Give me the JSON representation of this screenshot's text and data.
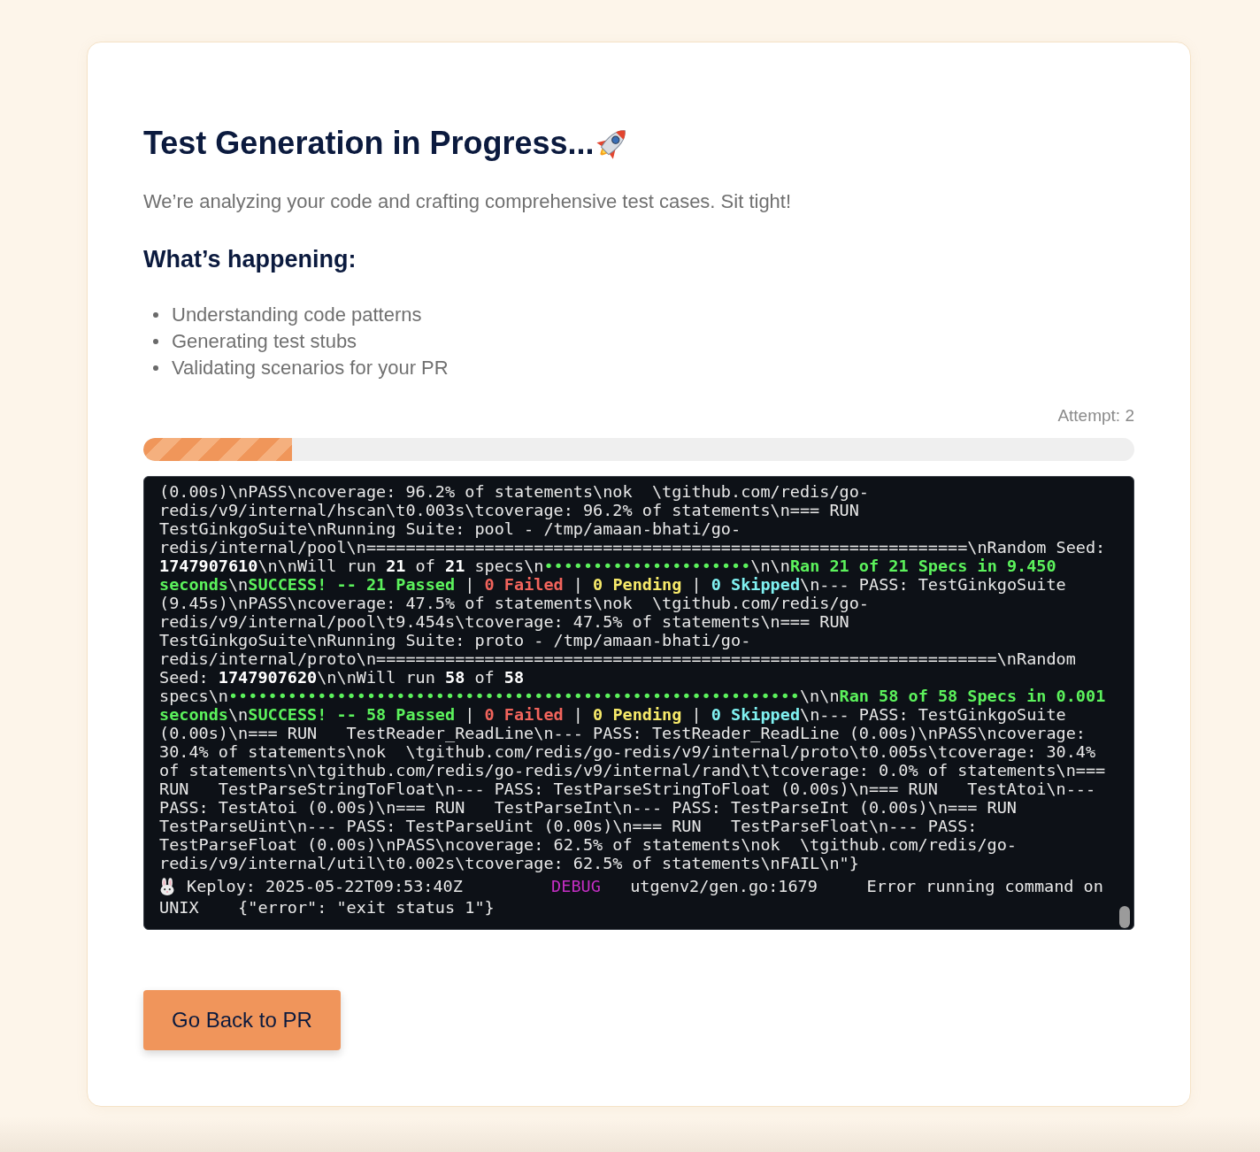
{
  "title": "Test Generation in Progress...",
  "subtitle": "We’re analyzing your code and crafting comprehensive test cases. Sit tight!",
  "steps_heading": "What’s happening:",
  "steps": [
    "Understanding code patterns",
    "Generating test stubs",
    "Validating scenarios for your PR"
  ],
  "attempt": "Attempt: 2",
  "progress": {
    "level": 0.15
  },
  "terminal": {
    "blocks": [
      {
        "kind": "output",
        "lines": [
          [
            {
              "kind": "plain",
              "text": "(0.00s)\\nPASS\\ncoverage: 96.2% of statements\\nok  \\tgithub.com/redis/go-"
            }
          ],
          [
            {
              "kind": "plain",
              "text": "redis/v9/internal/hscan\\t0.003s\\tcoverage: 96.2% of statements\\n=== RUN"
            }
          ],
          [
            {
              "kind": "plain",
              "text": "TestGinkgoSuite\\nRunning Suite: pool - /tmp/amaan-bhati/go-"
            }
          ],
          [
            {
              "kind": "plain",
              "text": "redis/internal/pool\\n=============================================================\\nRandom Seed:"
            }
          ],
          [
            {
              "kind": "bold",
              "text": "1747907610"
            },
            {
              "kind": "plain",
              "text": "\\n\\nWill run "
            },
            {
              "kind": "bold",
              "text": "21"
            },
            {
              "kind": "plain",
              "text": " of "
            },
            {
              "kind": "bold",
              "text": "21"
            },
            {
              "kind": "plain",
              "text": " specs\\n"
            },
            {
              "kind": "progress",
              "text": "•••••••••••••••••••••"
            },
            {
              "kind": "plain",
              "text": "\\n\\n"
            },
            {
              "kind": "pass",
              "text": "Ran 21 of 21 Specs in 9.450"
            }
          ],
          [
            {
              "kind": "pass",
              "text": "seconds"
            },
            {
              "kind": "plain",
              "text": "\\n"
            },
            {
              "kind": "pass",
              "text": "SUCCESS! -- 21 Passed"
            },
            {
              "kind": "plain",
              "text": " | "
            },
            {
              "kind": "fail",
              "text": "0 Failed"
            },
            {
              "kind": "plain",
              "text": " | "
            },
            {
              "kind": "pending",
              "text": "0 Pending"
            },
            {
              "kind": "plain",
              "text": " | "
            },
            {
              "kind": "skipped",
              "text": "0 Skipped"
            },
            {
              "kind": "plain",
              "text": "\\n--- PASS: TestGinkgoSuite"
            }
          ],
          [
            {
              "kind": "plain",
              "text": "(9.45s)\\nPASS\\ncoverage: 47.5% of statements\\nok  \\tgithub.com/redis/go-"
            }
          ],
          [
            {
              "kind": "plain",
              "text": "redis/v9/internal/pool\\t9.454s\\tcoverage: 47.5% of statements\\n=== RUN"
            }
          ],
          [
            {
              "kind": "plain",
              "text": "TestGinkgoSuite\\nRunning Suite: proto - /tmp/amaan-bhati/go-"
            }
          ],
          [
            {
              "kind": "plain",
              "text": "redis/internal/proto\\n===============================================================\\nRandom"
            }
          ],
          [
            {
              "kind": "plain",
              "text": "Seed: "
            },
            {
              "kind": "bold",
              "text": "1747907620"
            },
            {
              "kind": "plain",
              "text": "\\n\\nWill run "
            },
            {
              "kind": "bold",
              "text": "58"
            },
            {
              "kind": "plain",
              "text": " of "
            },
            {
              "kind": "bold",
              "text": "58"
            }
          ],
          [
            {
              "kind": "plain",
              "text": "specs\\n"
            },
            {
              "kind": "progress",
              "text": "••••••••••••••••••••••••••••••••••••••••••••••••••••••••••"
            },
            {
              "kind": "plain",
              "text": "\\n\\n"
            },
            {
              "kind": "pass",
              "text": "Ran 58 of 58 Specs in 0.001"
            }
          ],
          [
            {
              "kind": "pass",
              "text": "seconds"
            },
            {
              "kind": "plain",
              "text": "\\n"
            },
            {
              "kind": "pass",
              "text": "SUCCESS! -- 58 Passed"
            },
            {
              "kind": "plain",
              "text": " | "
            },
            {
              "kind": "fail",
              "text": "0 Failed"
            },
            {
              "kind": "plain",
              "text": " | "
            },
            {
              "kind": "pending",
              "text": "0 Pending"
            },
            {
              "kind": "plain",
              "text": " | "
            },
            {
              "kind": "skipped",
              "text": "0 Skipped"
            },
            {
              "kind": "plain",
              "text": "\\n--- PASS: TestGinkgoSuite"
            }
          ],
          [
            {
              "kind": "plain",
              "text": "(0.00s)\\n=== RUN   TestReader_ReadLine\\n--- PASS: TestReader_ReadLine (0.00s)\\nPASS\\ncoverage:"
            }
          ],
          [
            {
              "kind": "plain",
              "text": "30.4% of statements\\nok  \\tgithub.com/redis/go-redis/v9/internal/proto\\t0.005s\\tcoverage: 30.4%"
            }
          ],
          [
            {
              "kind": "plain",
              "text": "of statements\\n\\tgithub.com/redis/go-redis/v9/internal/rand\\t\\tcoverage: 0.0% of statements\\n==="
            }
          ],
          [
            {
              "kind": "plain",
              "text": "RUN   TestParseStringToFloat\\n--- PASS: TestParseStringToFloat (0.00s)\\n=== RUN   TestAtoi\\n---"
            }
          ],
          [
            {
              "kind": "plain",
              "text": "PASS: TestAtoi (0.00s)\\n=== RUN   TestParseInt\\n--- PASS: TestParseInt (0.00s)\\n=== RUN"
            }
          ],
          [
            {
              "kind": "plain",
              "text": "TestParseUint\\n--- PASS: TestParseUint (0.00s)\\n=== RUN   TestParseFloat\\n--- PASS:"
            }
          ],
          [
            {
              "kind": "plain",
              "text": "TestParseFloat (0.00s)\\nPASS\\ncoverage: 62.5% of statements\\nok  \\tgithub.com/redis/go-"
            }
          ],
          [
            {
              "kind": "plain",
              "text": "redis/v9/internal/util\\t0.002s\\tcoverage: 62.5% of statements\\nFAIL\\n\"}"
            }
          ]
        ]
      },
      {
        "kind": "keploy",
        "lines": [
          [
            {
              "kind": "plain",
              "text": "Keploy: 2025-05-22T09:53:40Z         "
            },
            {
              "kind": "debug",
              "text": "DEBUG"
            },
            {
              "kind": "plain",
              "text": "   utgenv2/gen.go:1679     Error running command on"
            }
          ],
          [
            {
              "kind": "plain",
              "text": "UNIX    {\"error\": \"exit status 1\"}"
            }
          ]
        ]
      }
    ]
  },
  "button": "Go Back to PR"
}
